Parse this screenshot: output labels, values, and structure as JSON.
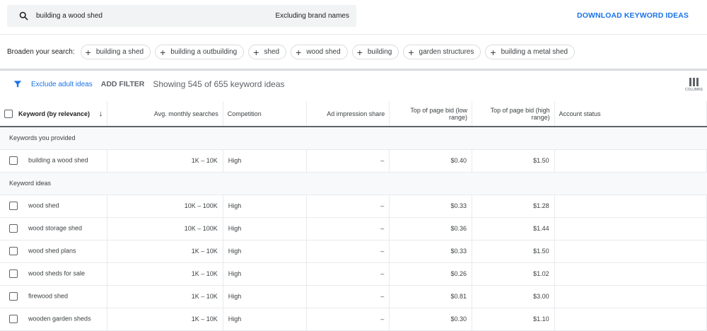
{
  "search": {
    "query": "building a wood shed",
    "exclusion": "Excluding brand names",
    "icon": "search-icon"
  },
  "download_label": "DOWNLOAD KEYWORD IDEAS",
  "broaden": {
    "label": "Broaden your search:",
    "chips": [
      "building a shed",
      "building a outbuilding",
      "shed",
      "wood shed",
      "building",
      "garden structures",
      "building a metal shed"
    ]
  },
  "filter": {
    "exclude_adult": "Exclude adult ideas",
    "add_filter": "ADD FILTER",
    "showing": "Showing 545 of 655 keyword ideas",
    "columns": "COLUMNS"
  },
  "table": {
    "headers": [
      "Keyword (by relevance)",
      "Avg. monthly searches",
      "Competition",
      "Ad impression share",
      "Top of page bid (low range)",
      "Top of page bid (high range)",
      "Account status"
    ],
    "groups": [
      {
        "label": "Keywords you provided",
        "rows": [
          [
            "building a wood shed",
            "1K – 10K",
            "High",
            "–",
            "$0.40",
            "$1.50",
            ""
          ]
        ]
      },
      {
        "label": "Keyword ideas",
        "rows": [
          [
            "wood shed",
            "10K – 100K",
            "High",
            "–",
            "$0.33",
            "$1.28",
            ""
          ],
          [
            "wood storage shed",
            "10K – 100K",
            "High",
            "–",
            "$0.36",
            "$1.44",
            ""
          ],
          [
            "wood shed plans",
            "1K – 10K",
            "High",
            "–",
            "$0.33",
            "$1.50",
            ""
          ],
          [
            "wood sheds for sale",
            "1K – 10K",
            "High",
            "–",
            "$0.26",
            "$1.02",
            ""
          ],
          [
            "firewood shed",
            "1K – 10K",
            "High",
            "–",
            "$0.81",
            "$3.00",
            ""
          ],
          [
            "wooden garden sheds",
            "1K – 10K",
            "High",
            "–",
            "$0.30",
            "$1.10",
            ""
          ]
        ]
      }
    ]
  },
  "colors": {
    "accent": "#1a73e8"
  }
}
